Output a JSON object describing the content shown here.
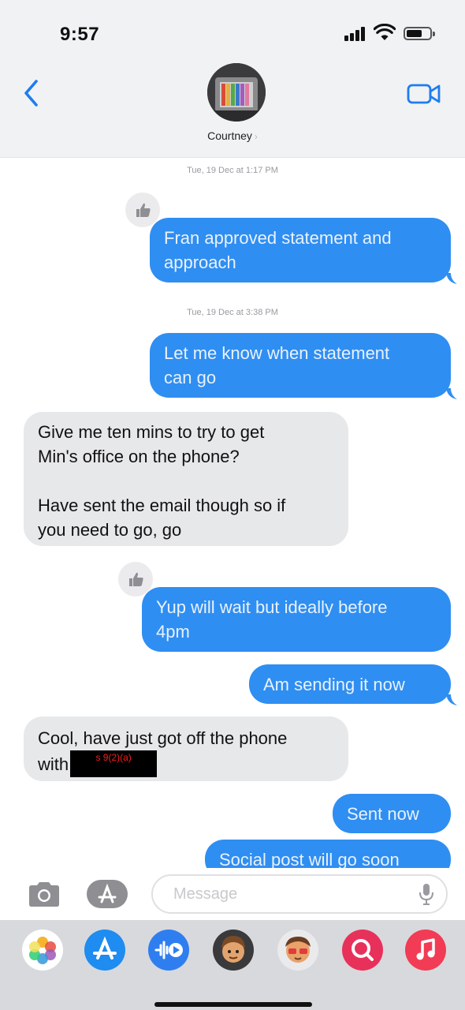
{
  "status_bar": {
    "time": "9:57"
  },
  "header": {
    "contact_name": "Courtney",
    "contact_chevron": "›"
  },
  "thread": {
    "timestamps": [
      "Tue, 19 Dec at 1:17 PM",
      "Tue, 19 Dec at 3:38 PM"
    ],
    "messages": [
      {
        "direction": "outgoing",
        "lines": [
          "Fran approved statement and",
          "approach"
        ],
        "tapback": "thumbs-up-icon"
      },
      {
        "direction": "outgoing",
        "lines": [
          "Let me know when statement",
          "can go"
        ]
      },
      {
        "direction": "incoming",
        "lines": [
          "Give me ten mins to try to get",
          "Min's office on the phone?",
          "",
          "Have sent the email though so if",
          "you need to go, go"
        ]
      },
      {
        "direction": "outgoing",
        "lines": [
          "Yup will wait but ideally before",
          "4pm"
        ],
        "tapback": "thumbs-up-icon"
      },
      {
        "direction": "outgoing",
        "lines": [
          "Am sending it now"
        ]
      },
      {
        "direction": "incoming",
        "lines": [
          "Cool, have just got off the phone",
          "with"
        ],
        "redaction_label": "s 9(2)(a)"
      },
      {
        "direction": "outgoing",
        "lines": [
          "Sent now"
        ]
      },
      {
        "direction": "outgoing",
        "lines": [
          "Social post will go soon"
        ]
      }
    ]
  },
  "compose": {
    "placeholder": "Message"
  },
  "icons": {
    "back": "chevron-left-icon",
    "video": "video-camera-icon",
    "camera": "camera-icon",
    "apps": "app-store-icon",
    "mic": "microphone-icon"
  },
  "app_drawer": [
    "photos-app-icon",
    "app-store-app-icon",
    "audio-message-app-icon",
    "memoji-app-icon",
    "memoji-stickers-app-icon",
    "image-search-app-icon",
    "music-app-icon"
  ],
  "colors": {
    "outgoing_bubble": "#2f8ef1",
    "incoming_bubble": "#e7e8ea",
    "accent": "#1f7cf0",
    "redaction_text": "#ff1a1a"
  }
}
